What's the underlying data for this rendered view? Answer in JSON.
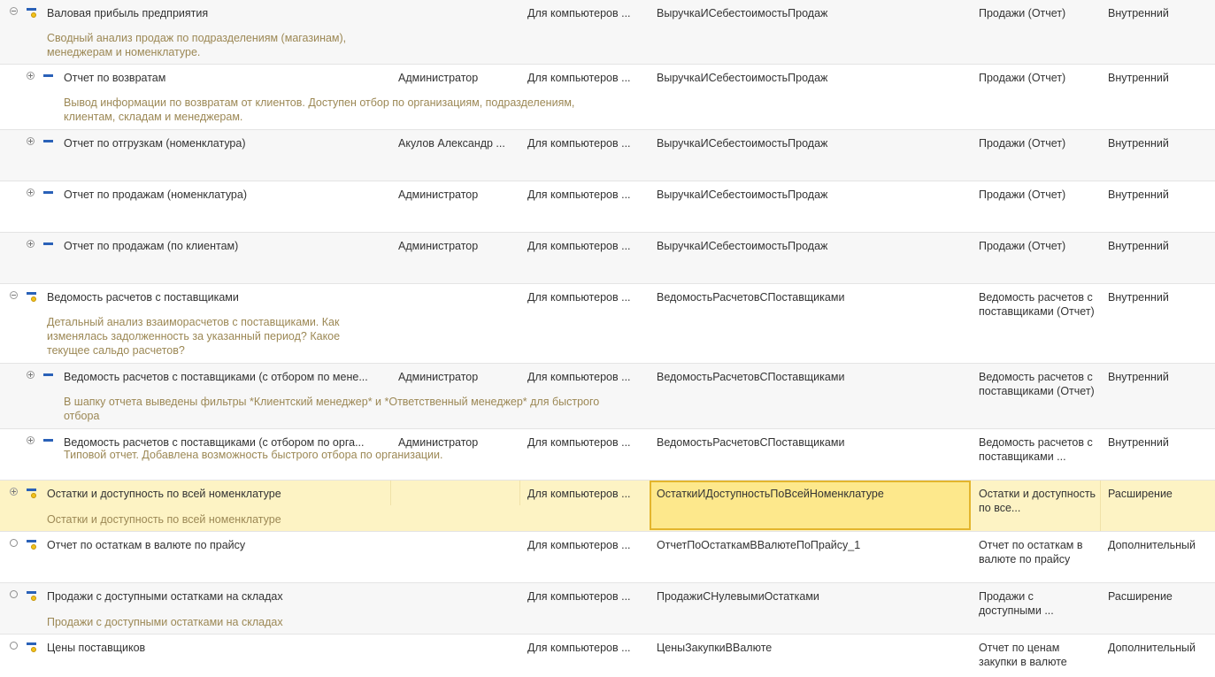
{
  "rows": [
    {
      "tree": "minus",
      "title": "Валовая прибыль предприятия",
      "author": "",
      "avail": "Для компьютеров ...",
      "name": "ВыручкаИСебестоимостьПродаж",
      "option": "Продажи (Отчет)",
      "type": "Внутренний",
      "desc": "Сводный анализ продаж по подразделениям (магазинам), менеджерам и номенклатуре."
    },
    {
      "tree": "plus",
      "title": "Отчет по возвратам",
      "author": "Администратор",
      "avail": "Для компьютеров ...",
      "name": "ВыручкаИСебестоимостьПродаж",
      "option": "Продажи (Отчет)",
      "type": "Внутренний",
      "desc": "Вывод информации по возвратам от клиентов. Доступен отбор по организациям, подразделениям, клиентам, складам и менеджерам."
    },
    {
      "tree": "plus",
      "title": "Отчет по отгрузкам (номенклатура)",
      "author": "Акулов Александр ...",
      "avail": "Для компьютеров ...",
      "name": "ВыручкаИСебестоимостьПродаж",
      "option": "Продажи (Отчет)",
      "type": "Внутренний",
      "desc": ""
    },
    {
      "tree": "plus",
      "title": "Отчет по продажам (номенклатура)",
      "author": "Администратор",
      "avail": "Для компьютеров ...",
      "name": "ВыручкаИСебестоимостьПродаж",
      "option": "Продажи (Отчет)",
      "type": "Внутренний",
      "desc": ""
    },
    {
      "tree": "plus",
      "title": "Отчет по продажам (по клиентам)",
      "author": "Администратор",
      "avail": "Для компьютеров ...",
      "name": "ВыручкаИСебестоимостьПродаж",
      "option": "Продажи (Отчет)",
      "type": "Внутренний",
      "desc": ""
    },
    {
      "tree": "minus",
      "title": "Ведомость расчетов с поставщиками",
      "author": "",
      "avail": "Для компьютеров ...",
      "name": "ВедомостьРасчетовСПоставщиками",
      "option": "Ведомость расчетов с поставщиками (Отчет)",
      "type": "Внутренний",
      "desc": "Детальный анализ взаиморасчетов с поставщиками. Как изменялась задолженность за указанный период? Какое текущее сальдо расчетов?"
    },
    {
      "tree": "plus",
      "title": "Ведомость расчетов с поставщиками (с отбором по мене...",
      "author": "Администратор",
      "avail": "Для компьютеров ...",
      "name": "ВедомостьРасчетовСПоставщиками",
      "option": "Ведомость расчетов с поставщиками (Отчет)",
      "type": "Внутренний",
      "desc": "В шапку отчета выведены фильтры *Клиентский менеджер* и *Ответственный менеджер* для быстрого отбора"
    },
    {
      "tree": "plus",
      "title": "Ведомость расчетов с поставщиками (с отбором по орга...",
      "author": "Администратор",
      "avail": "Для компьютеров ...",
      "name": "ВедомостьРасчетовСПоставщиками",
      "option": "Ведомость расчетов с поставщиками ...",
      "type": "Внутренний",
      "desc": "Типовой отчет. Добавлена возможность быстрого отбора по организации."
    },
    {
      "tree": "plus",
      "title": "Остатки и доступность по всей номенклатуре",
      "author": "",
      "avail": "Для компьютеров ...",
      "name": "ОстаткиИДоступностьПоВсейНоменклатуре",
      "option": "Остатки и доступность по все...",
      "type": "Расширение",
      "desc": "Остатки и доступность по всей номенклатуре"
    },
    {
      "tree": "circle",
      "title": "Отчет по остаткам в валюте по прайсу",
      "author": "",
      "avail": "Для компьютеров ...",
      "name": "ОтчетПоОстаткамВВалютеПоПрайсу_1",
      "option": "Отчет по остаткам в валюте по прайсу",
      "type": "Дополнительный",
      "desc": ""
    },
    {
      "tree": "circle",
      "title": "Продажи с доступными остатками на складах",
      "author": "",
      "avail": "Для компьютеров ...",
      "name": "ПродажиСНулевымиОстатками",
      "option": "Продажи с доступными ...",
      "type": "Расширение",
      "desc": "Продажи с доступными остатками на складах"
    },
    {
      "tree": "circle",
      "title": "Цены поставщиков",
      "author": "",
      "avail": "Для компьютеров ...",
      "name": "ЦеныЗакупкиВВалюте",
      "option": "Отчет по ценам закупки в валюте",
      "type": "Дополнительный",
      "desc": ""
    }
  ]
}
